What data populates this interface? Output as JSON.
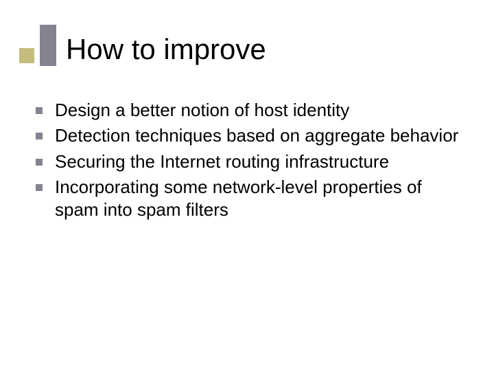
{
  "title": "How to improve",
  "bullets": [
    "Design a better notion of host identity",
    "Detection techniques based on aggregate behavior",
    "Securing the Internet routing infrastructure",
    "Incorporating some network-level properties of spam into spam filters"
  ]
}
